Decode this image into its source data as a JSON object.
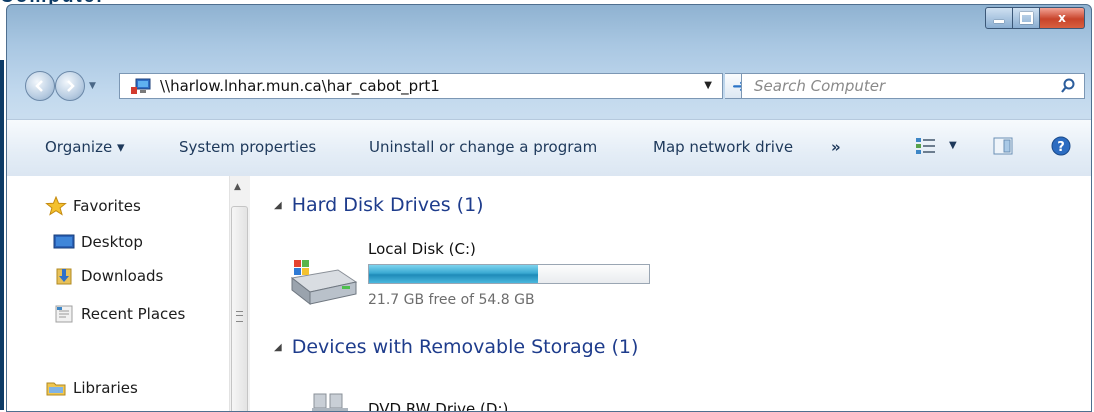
{
  "caption_fragment": "Computer",
  "window": {
    "buttons": {
      "minimize": "minimize",
      "maximize": "maximize",
      "close_label": "x"
    }
  },
  "address_bar": {
    "path": "\\\\harlow.lnhar.mun.ca\\har_cabot_prt1"
  },
  "search": {
    "placeholder": "Search Computer"
  },
  "toolbar": {
    "organize": "Organize ▾",
    "system_properties": "System properties",
    "uninstall": "Uninstall or change a program",
    "map_drive": "Map network drive",
    "more": "»"
  },
  "sidebar": {
    "items": [
      {
        "label": "Favorites",
        "icon": "star-icon"
      },
      {
        "label": "Desktop",
        "icon": "desktop-icon"
      },
      {
        "label": "Downloads",
        "icon": "downloads-icon"
      },
      {
        "label": "Recent Places",
        "icon": "recent-places-icon"
      },
      {
        "label": "Libraries",
        "icon": "libraries-icon"
      }
    ]
  },
  "groups": [
    {
      "header": "Hard Disk Drives (1)",
      "drives": [
        {
          "name": "Local Disk (C:)",
          "free_text": "21.7 GB free of 54.8 GB",
          "used_fraction": 0.604
        }
      ]
    },
    {
      "header": "Devices with Removable Storage (1)",
      "drives": [
        {
          "name": "DVD RW Drive (D:)"
        }
      ]
    }
  ],
  "colors": {
    "group_header": "#1e3c8c",
    "toolbar_text": "#1e395b",
    "disk_bar": "#2a9fd0",
    "close_button": "#c8442b"
  }
}
